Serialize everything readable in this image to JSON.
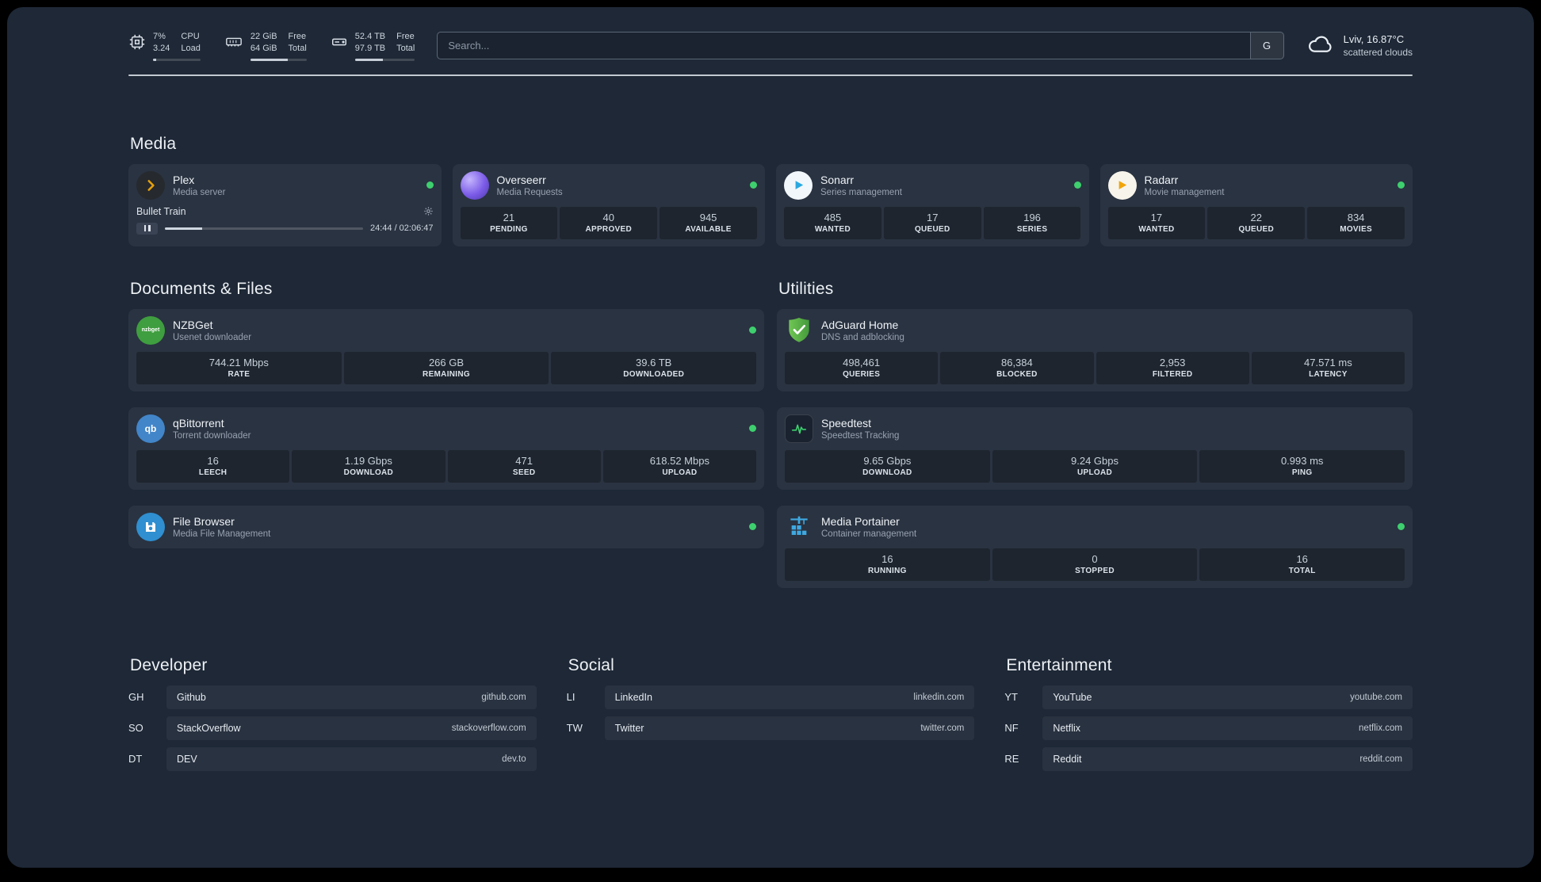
{
  "topbar": {
    "resources": [
      {
        "id": "cpu",
        "col1_top": "7%",
        "col1_bottom": "3.24",
        "col2_top": "CPU",
        "col2_bottom": "Load",
        "bar": 7
      },
      {
        "id": "memory",
        "col1_top": "22 GiB",
        "col1_bottom": "64 GiB",
        "col2_top": "Free",
        "col2_bottom": "Total",
        "bar": 66
      },
      {
        "id": "disk",
        "col1_top": "52.4 TB",
        "col1_bottom": "97.9 TB",
        "col2_top": "Free",
        "col2_bottom": "Total",
        "bar": 46
      }
    ],
    "search": {
      "placeholder": "Search...",
      "provider_label": "G"
    },
    "weather": {
      "location": "Lviv, 16.87°C",
      "condition": "scattered clouds"
    }
  },
  "groups": {
    "media": {
      "title": "Media"
    },
    "documents": {
      "title": "Documents & Files"
    },
    "utilities": {
      "title": "Utilities"
    }
  },
  "services": {
    "plex": {
      "name": "Plex",
      "desc": "Media server",
      "player": {
        "title": "Bullet Train",
        "time": "24:44 / 02:06:47",
        "progress": 19
      }
    },
    "overseerr": {
      "name": "Overseerr",
      "desc": "Media Requests",
      "stats": [
        {
          "value": "21",
          "label": "PENDING"
        },
        {
          "value": "40",
          "label": "APPROVED"
        },
        {
          "value": "945",
          "label": "AVAILABLE"
        }
      ]
    },
    "sonarr": {
      "name": "Sonarr",
      "desc": "Series management",
      "stats": [
        {
          "value": "485",
          "label": "WANTED"
        },
        {
          "value": "17",
          "label": "QUEUED"
        },
        {
          "value": "196",
          "label": "SERIES"
        }
      ]
    },
    "radarr": {
      "name": "Radarr",
      "desc": "Movie management",
      "stats": [
        {
          "value": "17",
          "label": "WANTED"
        },
        {
          "value": "22",
          "label": "QUEUED"
        },
        {
          "value": "834",
          "label": "MOVIES"
        }
      ]
    },
    "nzbget": {
      "name": "NZBGet",
      "desc": "Usenet downloader",
      "icon_text": "nzbget",
      "stats": [
        {
          "value": "744.21 Mbps",
          "label": "RATE"
        },
        {
          "value": "266 GB",
          "label": "REMAINING"
        },
        {
          "value": "39.6 TB",
          "label": "DOWNLOADED"
        }
      ]
    },
    "qbittorrent": {
      "name": "qBittorrent",
      "desc": "Torrent downloader",
      "icon_text": "qb",
      "stats": [
        {
          "value": "16",
          "label": "LEECH"
        },
        {
          "value": "1.19 Gbps",
          "label": "DOWNLOAD"
        },
        {
          "value": "471",
          "label": "SEED"
        },
        {
          "value": "618.52 Mbps",
          "label": "UPLOAD"
        }
      ]
    },
    "filebrowser": {
      "name": "File Browser",
      "desc": "Media File Management"
    },
    "adguard": {
      "name": "AdGuard Home",
      "desc": "DNS and adblocking",
      "stats": [
        {
          "value": "498,461",
          "label": "QUERIES"
        },
        {
          "value": "86,384",
          "label": "BLOCKED"
        },
        {
          "value": "2,953",
          "label": "FILTERED"
        },
        {
          "value": "47.571 ms",
          "label": "LATENCY"
        }
      ]
    },
    "speedtest": {
      "name": "Speedtest",
      "desc": "Speedtest Tracking",
      "stats": [
        {
          "value": "9.65 Gbps",
          "label": "DOWNLOAD"
        },
        {
          "value": "9.24 Gbps",
          "label": "UPLOAD"
        },
        {
          "value": "0.993 ms",
          "label": "PING"
        }
      ]
    },
    "portainer": {
      "name": "Media Portainer",
      "desc": "Container management",
      "stats": [
        {
          "value": "16",
          "label": "RUNNING"
        },
        {
          "value": "0",
          "label": "STOPPED"
        },
        {
          "value": "16",
          "label": "TOTAL"
        }
      ]
    }
  },
  "bookmarks": {
    "developer": {
      "title": "Developer",
      "items": [
        {
          "abbr": "GH",
          "name": "Github",
          "domain": "github.com"
        },
        {
          "abbr": "SO",
          "name": "StackOverflow",
          "domain": "stackoverflow.com"
        },
        {
          "abbr": "DT",
          "name": "DEV",
          "domain": "dev.to"
        }
      ]
    },
    "social": {
      "title": "Social",
      "items": [
        {
          "abbr": "LI",
          "name": "LinkedIn",
          "domain": "linkedin.com"
        },
        {
          "abbr": "TW",
          "name": "Twitter",
          "domain": "twitter.com"
        }
      ]
    },
    "entertainment": {
      "title": "Entertainment",
      "items": [
        {
          "abbr": "YT",
          "name": "YouTube",
          "domain": "youtube.com"
        },
        {
          "abbr": "NF",
          "name": "Netflix",
          "domain": "netflix.com"
        },
        {
          "abbr": "RE",
          "name": "Reddit",
          "domain": "reddit.com"
        }
      ]
    }
  }
}
